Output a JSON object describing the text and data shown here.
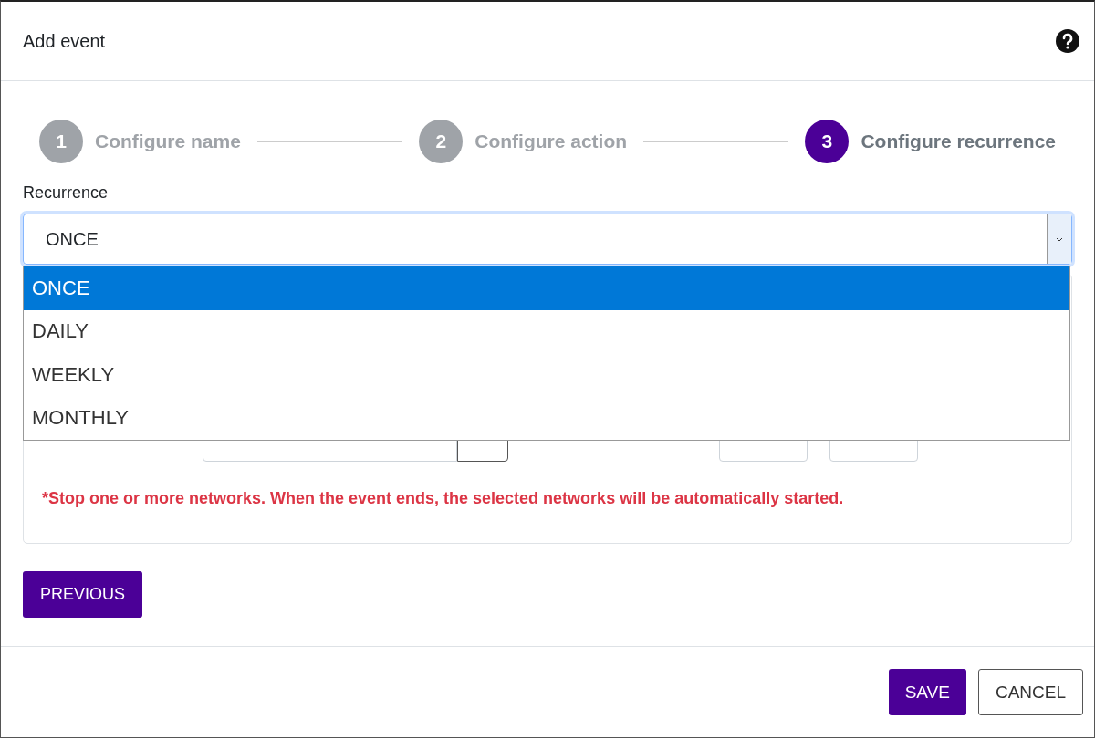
{
  "dialog": {
    "title": "Add event"
  },
  "steps": [
    {
      "number": "1",
      "label": "Configure name",
      "selected": false
    },
    {
      "number": "2",
      "label": "Configure action",
      "selected": false
    },
    {
      "number": "3",
      "label": "Configure recurrence",
      "selected": true
    }
  ],
  "recurrence": {
    "label": "Recurrence",
    "value": "ONCE",
    "expanded": true,
    "options": [
      {
        "label": "ONCE",
        "selected": true
      },
      {
        "label": "DAILY",
        "selected": false
      },
      {
        "label": "WEEKLY",
        "selected": false
      },
      {
        "label": "MONTHLY",
        "selected": false
      }
    ]
  },
  "note": "*Stop one or more networks. When the event ends, the selected networks will be automatically started.",
  "previous_button": "PREVIOUS",
  "footer_buttons": [
    {
      "label": "SAVE",
      "kind": "primary"
    },
    {
      "label": "CANCEL",
      "kind": "secondary"
    }
  ]
}
